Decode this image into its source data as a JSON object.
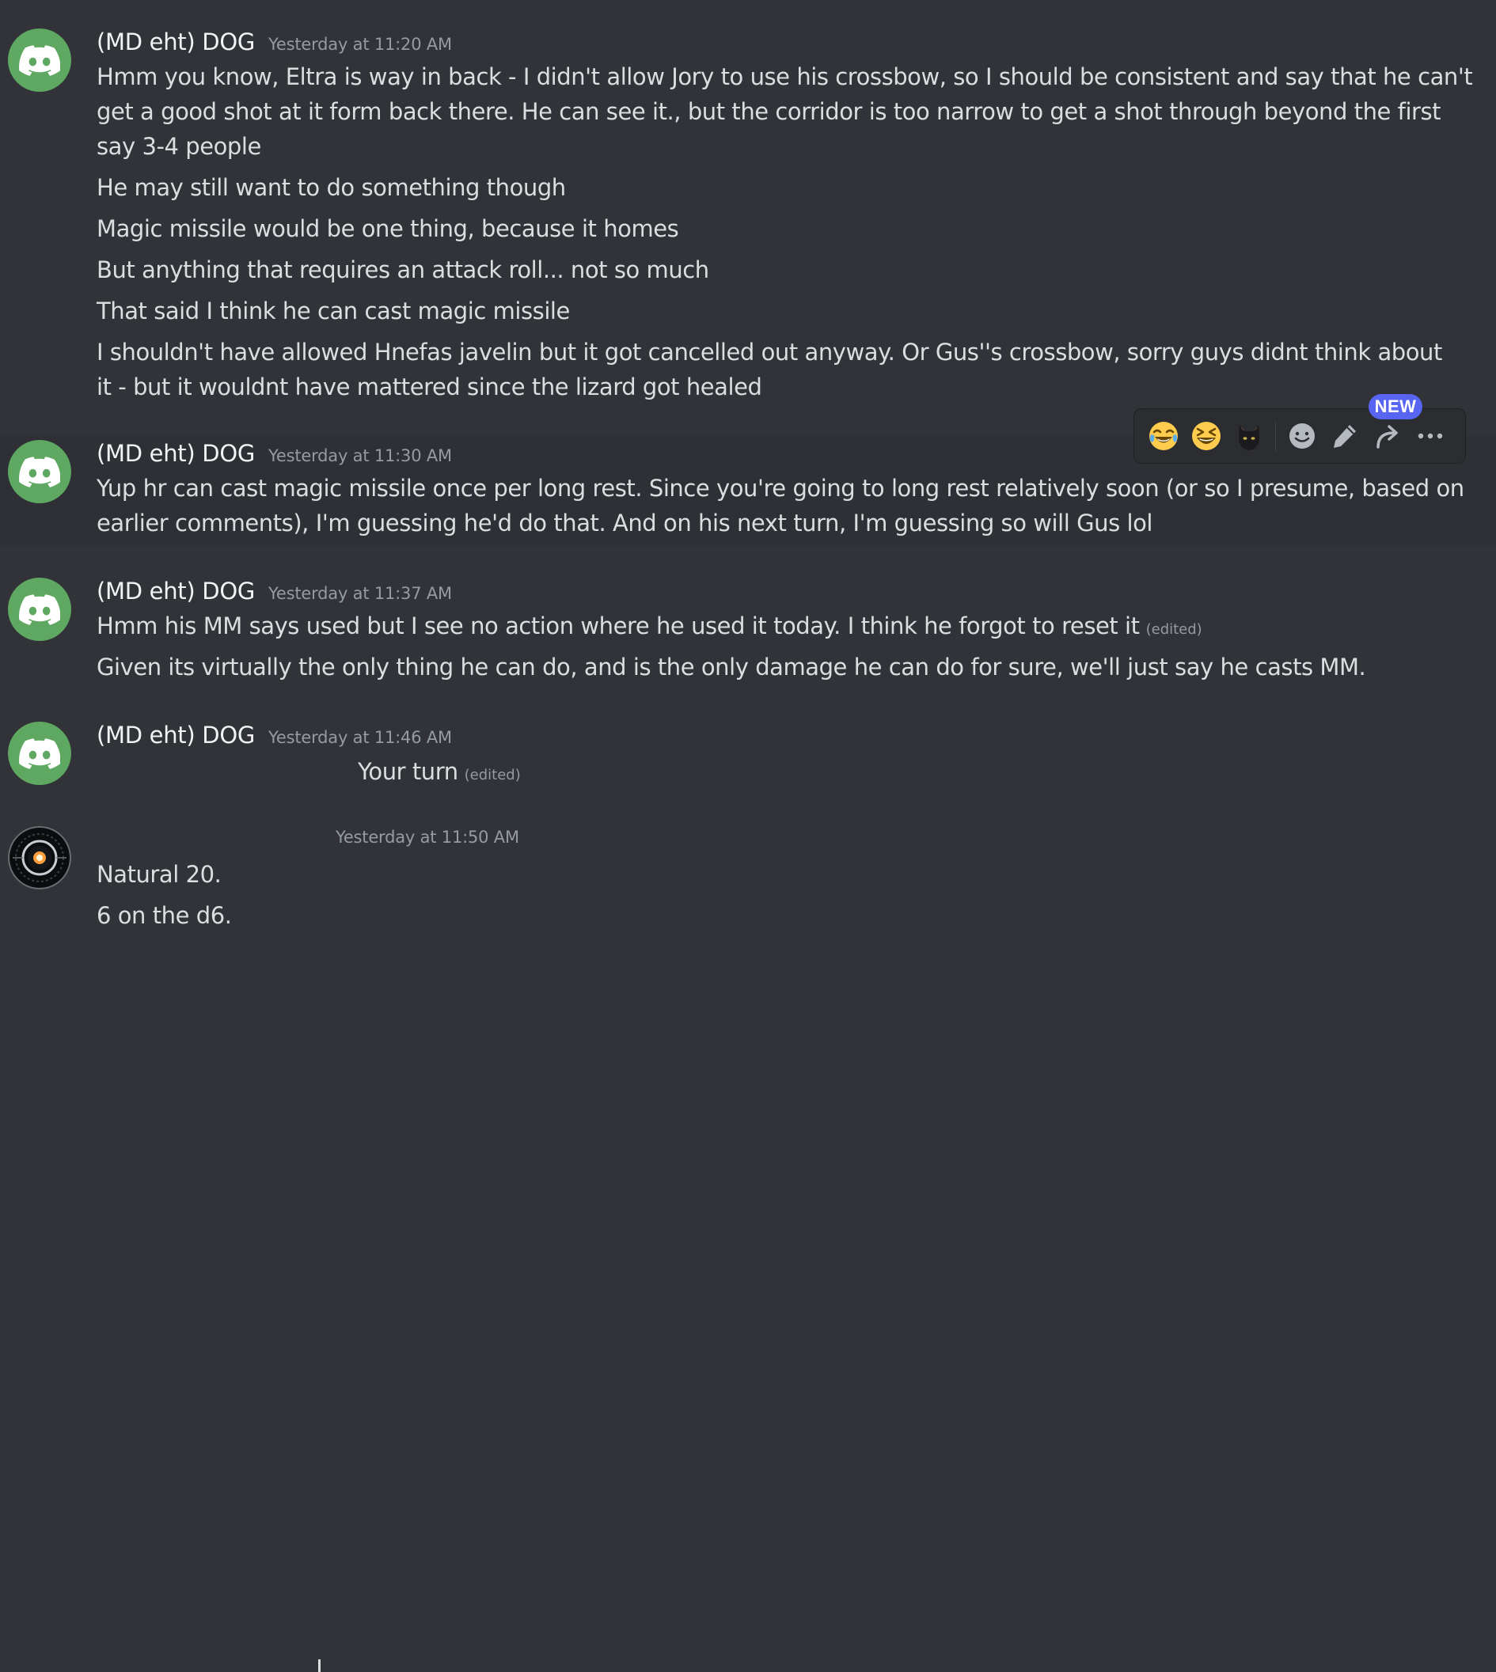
{
  "messages": [
    {
      "author": "(MD eht) DOG",
      "timestamp": "Yesterday at 11:20 AM",
      "lines": [
        "Hmm you know, Eltra is way in back - I didn't allow Jory to use his crossbow, so I should be consistent and say that he can't",
        "get a good shot at it form back there.  He can see it., but the corridor is too narrow to get a shot through beyond the first",
        "say 3-4 people",
        "He may still want to do something though",
        "Magic missile would be one thing, because it homes",
        "But anything that requires an attack roll... not so much",
        "That said I think he can cast magic missile",
        "I shouldn't have allowed Hnefas  javelin but it got cancelled out anyway.  Or Gus''s crossbow,  sorry guys didnt think about",
        "it - but it wouldnt have mattered since the lizard got healed"
      ]
    },
    {
      "author": "(MD eht) DOG",
      "timestamp": "Yesterday at 11:30 AM",
      "lines": [
        "Yup hr can cast magic missile once per long rest.  Since you're going to long rest relatively soon (or so I presume, based on",
        "earlier comments), I'm guessing he'd do that.  And on his next turn, I'm guessing so will Gus lol"
      ]
    },
    {
      "author": "(MD eht) DOG",
      "timestamp": "Yesterday at 11:37 AM",
      "lines": [
        "Hmm his MM says used but I see no action where he used it today.  I think he forgot to reset it",
        "Given its virtually the only thing he can do, and is the only damage he can do for sure, we'll just say he casts MM."
      ],
      "edited_label": "(edited)"
    },
    {
      "author": "(MD eht) DOG",
      "timestamp": "Yesterday at 11:46 AM",
      "lines": [
        "Your turn"
      ],
      "edited_label": "(edited)"
    },
    {
      "author": "",
      "timestamp": "Yesterday at 11:50 AM",
      "lines": [
        "Natural 20.",
        "6 on the d6."
      ]
    }
  ],
  "toolbar": {
    "reactions": [
      {
        "icon": "joy-emoji-icon",
        "glyph": "😂"
      },
      {
        "icon": "laughing-emoji-icon",
        "glyph": "😆"
      },
      {
        "icon": "black-cat-emoji-icon",
        "glyph": "🐈‍⬛"
      }
    ],
    "new_badge": "NEW",
    "buttons": [
      "add-reaction-icon",
      "edit-icon",
      "forward-icon",
      "more-icon"
    ]
  },
  "colors": {
    "background": "#313338",
    "hover_background": "#2e3035",
    "text": "#dbdee1",
    "muted": "#949ba4",
    "avatar_green": "#5fa862",
    "brand": "#5865f2"
  }
}
